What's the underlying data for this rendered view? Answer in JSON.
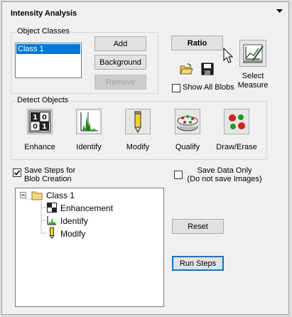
{
  "panel": {
    "title": "Intensity Analysis"
  },
  "object_classes": {
    "label": "Object Classes",
    "list": [
      "Class 1"
    ],
    "add_label": "Add",
    "background_label": "Background",
    "remove_label": "Remove"
  },
  "ratio": {
    "label": "Ratio"
  },
  "select_measure": {
    "line1": "Select",
    "line2": "Measure"
  },
  "show_all_blobs": {
    "label": "Show All Blobs",
    "checked": false
  },
  "detect": {
    "label": "Detect Objects",
    "tools": [
      {
        "label": "Enhance",
        "icon": "enhance-icon"
      },
      {
        "label": "Identify",
        "icon": "identify-icon"
      },
      {
        "label": "Modify",
        "icon": "pencil-icon"
      },
      {
        "label": "Qualify",
        "icon": "qualify-icon"
      },
      {
        "label": "Draw/Erase",
        "icon": "draw-erase-icon"
      }
    ]
  },
  "save_steps": {
    "line1": "Save Steps for",
    "line2": "Blob Creation",
    "checked": true
  },
  "save_data": {
    "line1": "Save Data Only",
    "line2": "(Do not save Images)",
    "checked": false
  },
  "tree": {
    "root": "Class 1",
    "children": [
      "Enhancement",
      "Identify",
      "Modify"
    ]
  },
  "reset_label": "Reset",
  "run_steps_label": "Run Steps"
}
